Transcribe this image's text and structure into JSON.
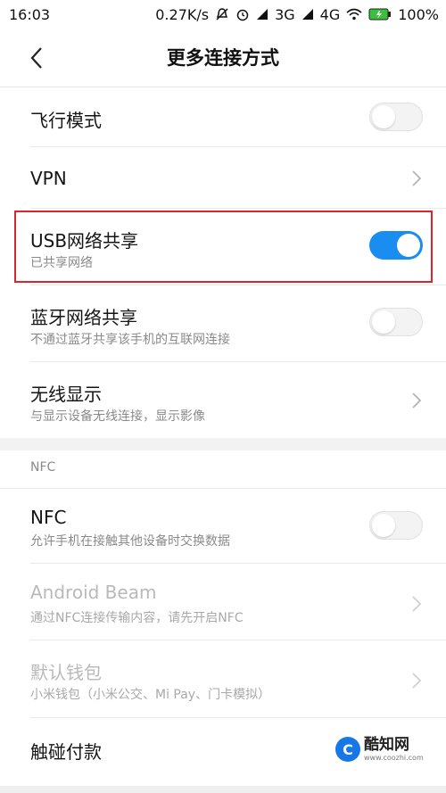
{
  "status_bar": {
    "time": "16:03",
    "net_speed": "0.27K/s",
    "network_3g": "3G",
    "network_4g": "4G",
    "battery": "100%",
    "icons": [
      "mute-icon",
      "alarm-icon",
      "signal-icon",
      "wifi-icon",
      "battery-icon"
    ]
  },
  "header": {
    "title": "更多连接方式",
    "back_icon": "chevron-left-icon"
  },
  "rows": {
    "airplane": {
      "title": "飞行模式",
      "toggle": false
    },
    "vpn": {
      "title": "VPN"
    },
    "usb_tethering": {
      "title": "USB网络共享",
      "subtitle": "已共享网络",
      "toggle": true
    },
    "bt_tethering": {
      "title": "蓝牙网络共享",
      "subtitle": "不通过蓝牙共享该手机的互联网连接",
      "toggle": false
    },
    "wireless_display": {
      "title": "无线显示",
      "subtitle": "与显示设备无线连接，显示影像"
    },
    "nfc": {
      "title": "NFC",
      "subtitle": "允许手机在接触其他设备时交换数据",
      "toggle": false
    },
    "android_beam": {
      "title": "Android Beam",
      "subtitle": "通过NFC连接传输内容，请先开启NFC"
    },
    "default_wallet": {
      "title": "默认钱包",
      "subtitle": "小米钱包（小米公交、Mi Pay、门卡模拟）"
    },
    "tap_pay": {
      "title": "触碰付款"
    }
  },
  "section_nfc": {
    "header": "NFC"
  },
  "watermark": {
    "logo": "C",
    "name": "酷知网",
    "url": "www.coozhi.com"
  },
  "colors": {
    "accent": "#1a8ef0",
    "highlight": "#d9262c"
  }
}
